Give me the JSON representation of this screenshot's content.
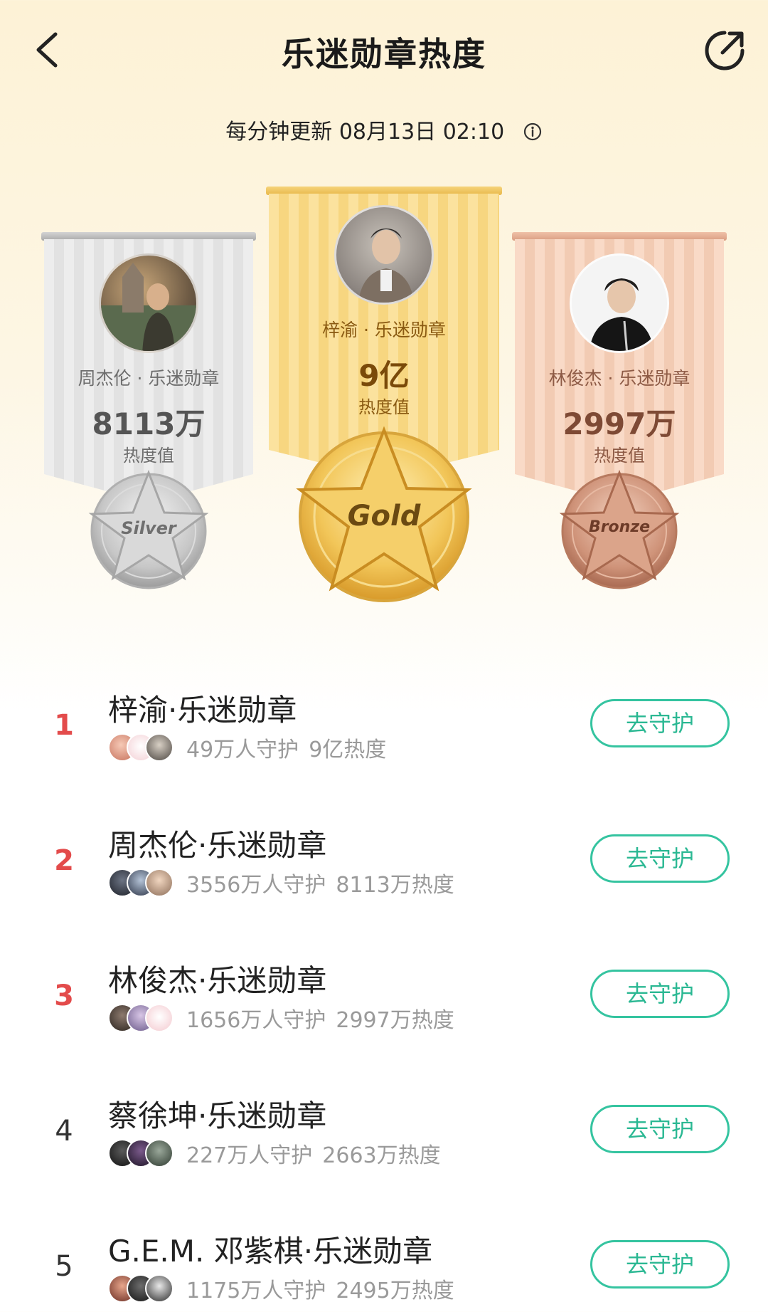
{
  "header": {
    "title": "乐迷勋章热度",
    "back_icon": "chevron-left-icon",
    "share_icon": "share-icon"
  },
  "update": {
    "text": "每分钟更新 08月13日 02:10",
    "info_icon": "info-icon"
  },
  "podium": {
    "silver": {
      "name": "周杰伦 · 乐迷勋章",
      "value": "8113万",
      "label": "热度值",
      "medal": "Silver"
    },
    "gold": {
      "name": "梓渝 · 乐迷勋章",
      "value": "9亿",
      "label": "热度值",
      "medal": "Gold"
    },
    "bronze": {
      "name": "林俊杰 · 乐迷勋章",
      "value": "2997万",
      "label": "热度值",
      "medal": "Bronze"
    }
  },
  "ranking": [
    {
      "rank": "1",
      "title": "梓渝·乐迷勋章",
      "guardians": "49万人守护",
      "heat": "9亿热度",
      "button": "去守护"
    },
    {
      "rank": "2",
      "title": "周杰伦·乐迷勋章",
      "guardians": "3556万人守护",
      "heat": "8113万热度",
      "button": "去守护"
    },
    {
      "rank": "3",
      "title": "林俊杰·乐迷勋章",
      "guardians": "1656万人守护",
      "heat": "2997万热度",
      "button": "去守护"
    },
    {
      "rank": "4",
      "title": "蔡徐坤·乐迷勋章",
      "guardians": "227万人守护",
      "heat": "2663万热度",
      "button": "去守护"
    },
    {
      "rank": "5",
      "title": "G.E.M. 邓紫棋·乐迷勋章",
      "guardians": "1175万人守护",
      "heat": "2495万热度",
      "button": "去守护"
    }
  ],
  "colors": {
    "accent_green": "#2bb893",
    "rank_red": "#e34b4b",
    "gold": "#f8d784",
    "silver": "#e3e3e3",
    "bronze": "#f3cdb6"
  }
}
